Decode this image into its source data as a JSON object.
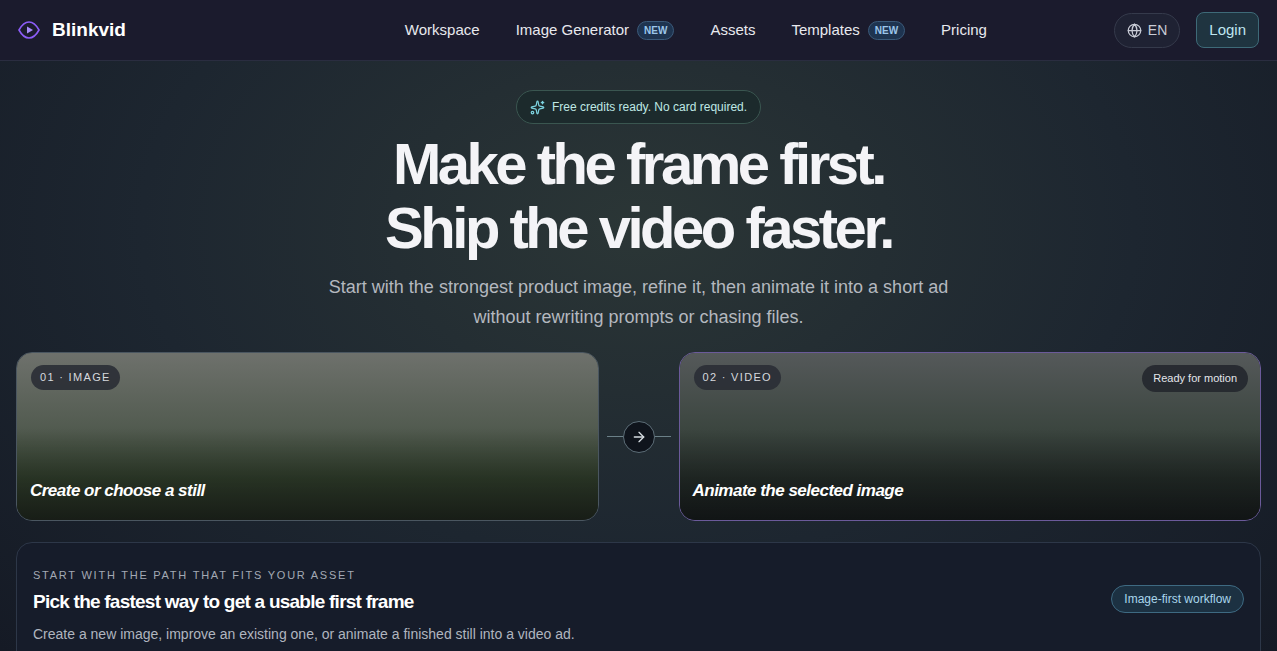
{
  "nav": {
    "brand": "Blinkvid",
    "links": [
      {
        "label": "Workspace"
      },
      {
        "label": "Image Generator",
        "badge": "NEW"
      },
      {
        "label": "Assets"
      },
      {
        "label": "Templates",
        "badge": "NEW"
      },
      {
        "label": "Pricing"
      }
    ],
    "language": "EN",
    "login": "Login"
  },
  "hero": {
    "pill": "Free credits ready. No card required.",
    "headline": [
      "Make the frame first.",
      "Ship the video faster."
    ],
    "subtitle": [
      "Start with the strongest product image, refine it, then animate it into a short ad",
      "without rewriting prompts or chasing files."
    ]
  },
  "steps": [
    {
      "badge": "01 · IMAGE",
      "caption": "Create or choose a still",
      "selected": false
    },
    {
      "badge": "02 · VIDEO",
      "caption": "Animate the selected image",
      "status": "Ready for motion",
      "selected": true
    }
  ],
  "section": {
    "eyebrow": "START WITH THE PATH THAT FITS YOUR ASSET",
    "title": "Pick the fastest way to get a usable first frame",
    "description": "Create a new image, improve an existing one, or animate a finished still into a video ad.",
    "tag": "Image-first workflow"
  }
}
